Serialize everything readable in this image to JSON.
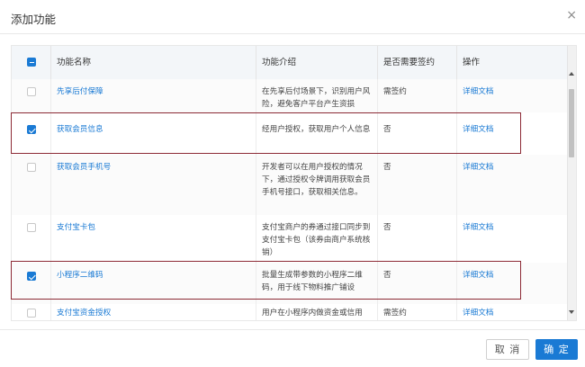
{
  "dialog": {
    "title": "添加功能",
    "close_glyph": "×"
  },
  "table": {
    "headers": [
      "功能名称",
      "功能介绍",
      "是否需要签约",
      "操作"
    ],
    "select_all_state": "partial",
    "rows": [
      {
        "name": "先享后付保障",
        "desc": "在先享后付场景下，识别用户风险，避免客户平台产生资损",
        "sign": "需签约",
        "action": "详细文档",
        "checked": false
      },
      {
        "name": "获取会员信息",
        "desc": "经用户授权，获取用户个人信息",
        "sign": "否",
        "action": "详细文档",
        "checked": true
      },
      {
        "name": "获取会员手机号",
        "desc": "开发者可以在用户授权的情况下，通过授权令牌调用获取会员手机号接口，获取相关信息。",
        "sign": "否",
        "action": "详细文档",
        "checked": false
      },
      {
        "name": "支付宝卡包",
        "desc": "支付宝商户的券通过接口同步到支付宝卡包（该券由商户系统核销）",
        "sign": "否",
        "action": "详细文档",
        "checked": false
      },
      {
        "name": "小程序二维码",
        "desc": "批量生成带参数的小程序二维码，用于线下物料推广铺设",
        "sign": "否",
        "action": "详细文档",
        "checked": true
      },
      {
        "name": "支付宝资金授权",
        "desc": "用户在小程序内做资金或信用",
        "sign": "需签约",
        "action": "详细文档",
        "checked": false
      }
    ]
  },
  "footer": {
    "cancel_label": "取 消",
    "ok_label": "确 定"
  },
  "colors": {
    "accent": "#1a7ad4",
    "highlight_border": "#8c2a35"
  }
}
